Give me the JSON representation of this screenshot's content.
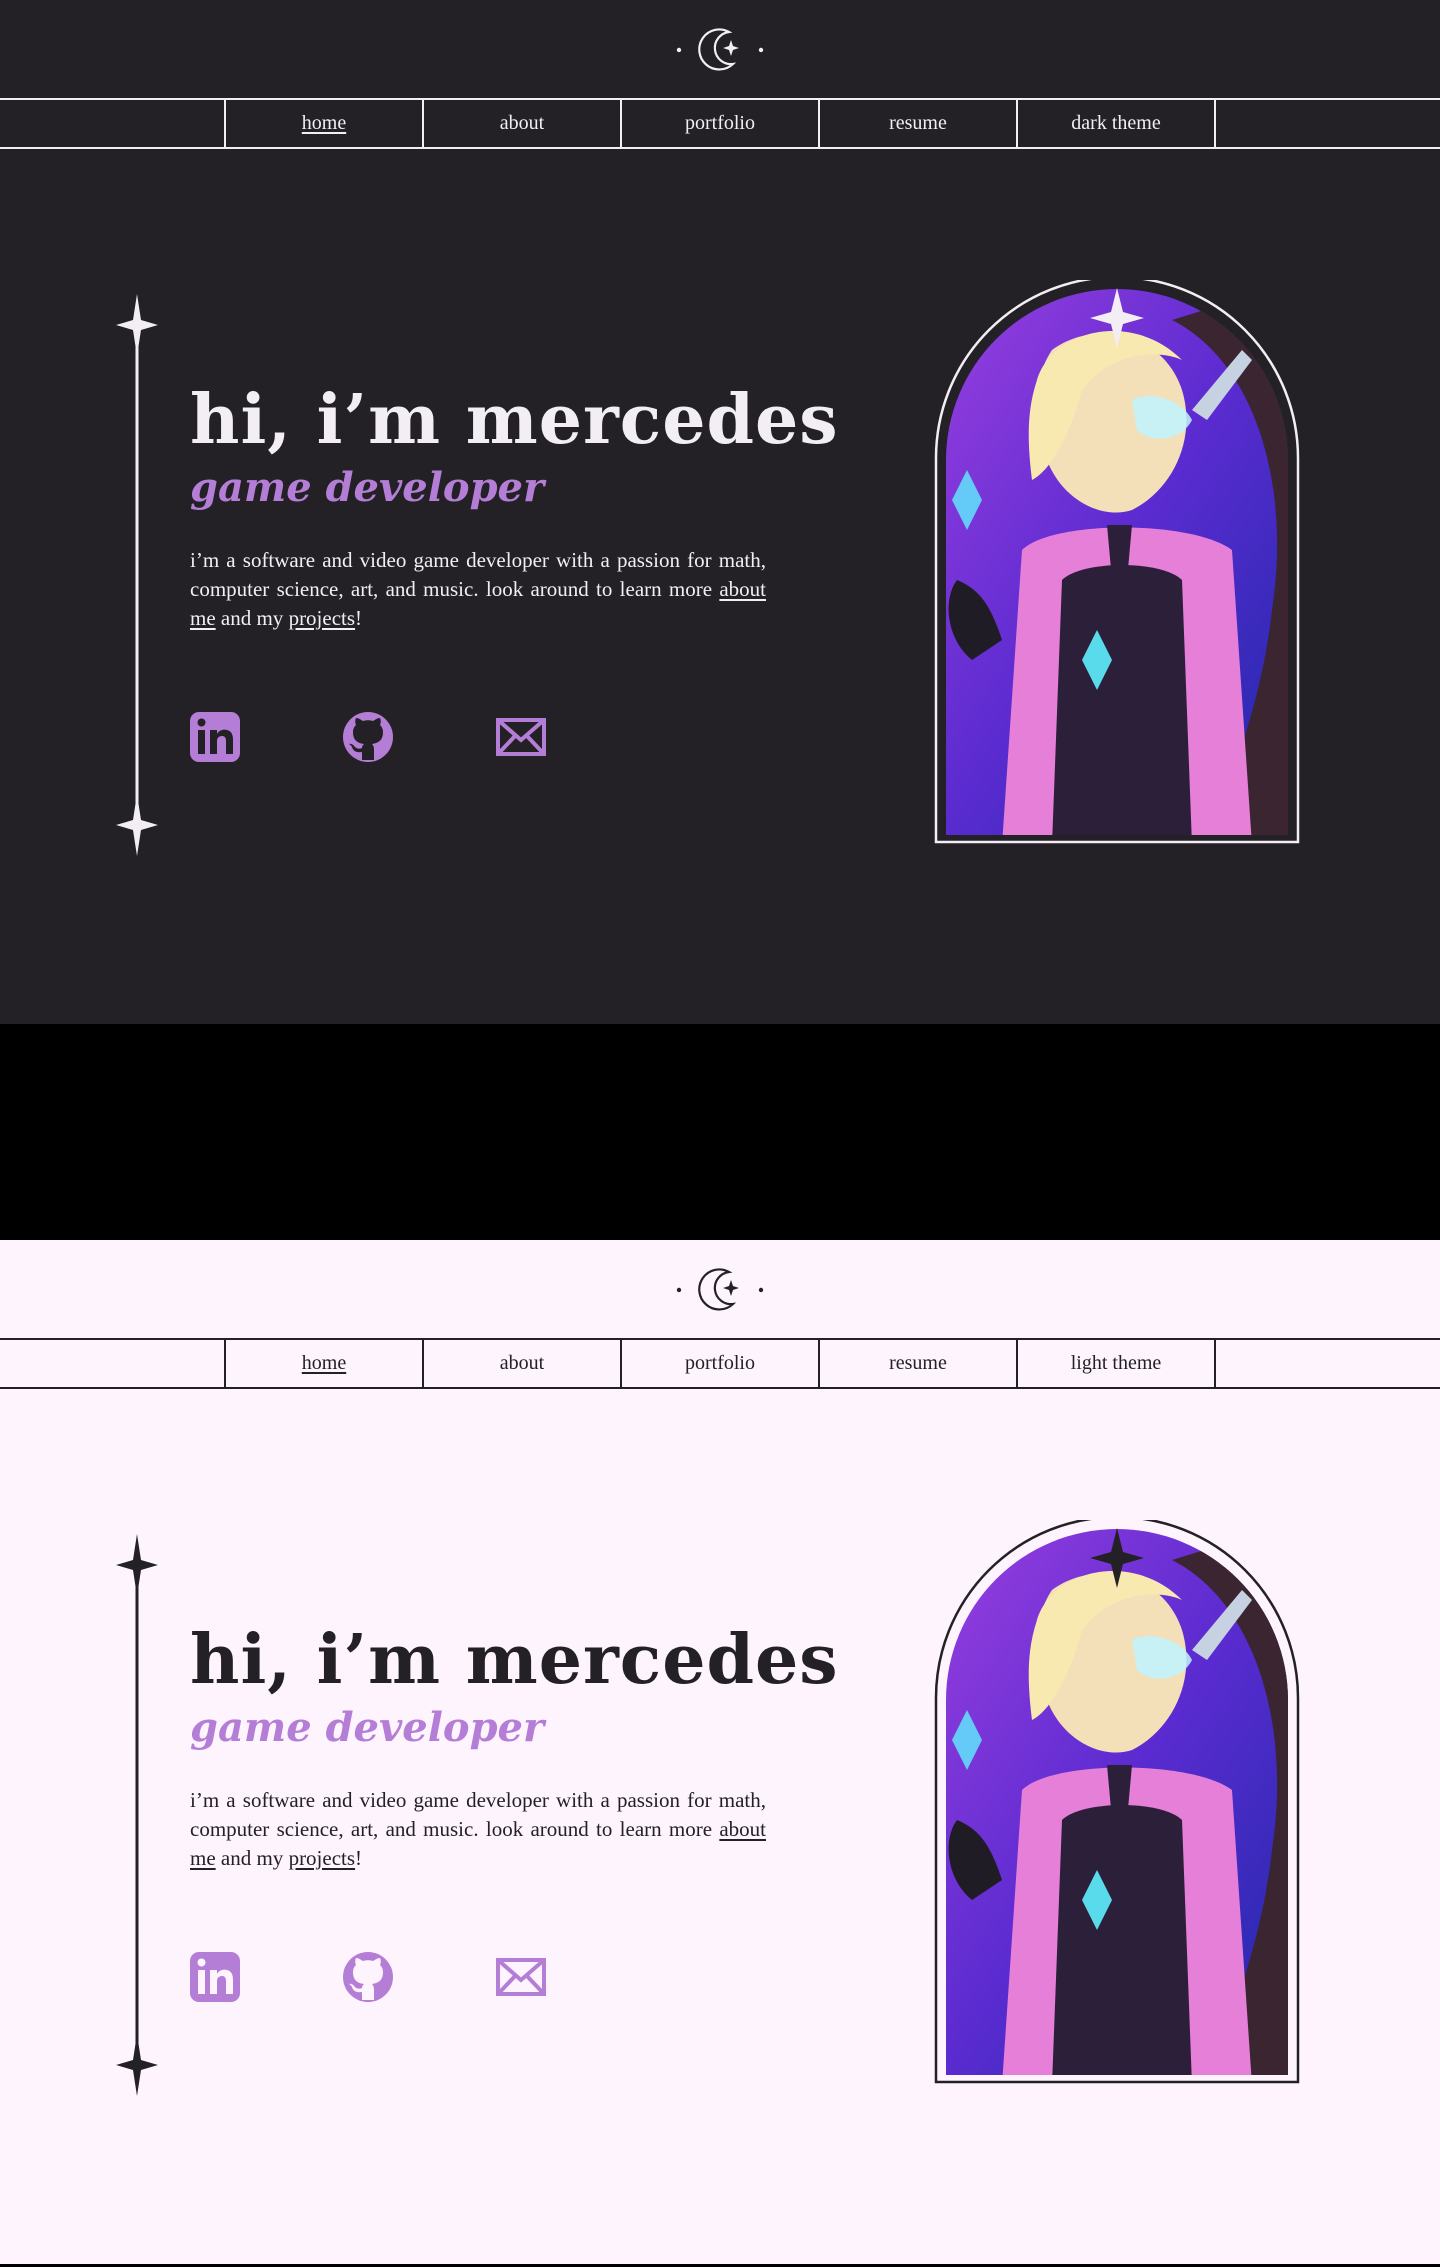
{
  "colors": {
    "dark_bg": "#242126",
    "light_bg": "#fdf4fd",
    "accent": "#b57ed6",
    "ink_dark": "#f2eef3",
    "ink_light": "#242126"
  },
  "icons": {
    "logo": "crescent-moon-sparkle-icon",
    "ornament": "four-point-star-icon",
    "linkedin": "linkedin-icon",
    "github": "github-icon",
    "email": "envelope-icon"
  },
  "dark": {
    "nav": [
      {
        "label": "home",
        "active": true
      },
      {
        "label": "about",
        "active": false
      },
      {
        "label": "portfolio",
        "active": false
      },
      {
        "label": "resume",
        "active": false
      },
      {
        "label": "dark theme",
        "active": false
      }
    ],
    "hero": {
      "title": "hi, i’m mercedes",
      "subtitle": "game developer",
      "bio_start": "i’m a software and video game developer with a passion for math, computer science, art, and music. look around to learn more ",
      "link_about": "about me",
      "bio_mid": " and my ",
      "link_projects": "projects",
      "bio_end": "!"
    }
  },
  "light": {
    "nav": [
      {
        "label": "home",
        "active": true
      },
      {
        "label": "about",
        "active": false
      },
      {
        "label": "portfolio",
        "active": false
      },
      {
        "label": "resume",
        "active": false
      },
      {
        "label": "light theme",
        "active": false
      }
    ],
    "hero": {
      "title": "hi, i’m mercedes",
      "subtitle": "game developer",
      "bio_start": "i’m a software and video game developer with a passion for math, computer science, art, and music. look around to learn more ",
      "link_about": "about me",
      "bio_mid": " and my ",
      "link_projects": "projects",
      "bio_end": "!"
    }
  }
}
